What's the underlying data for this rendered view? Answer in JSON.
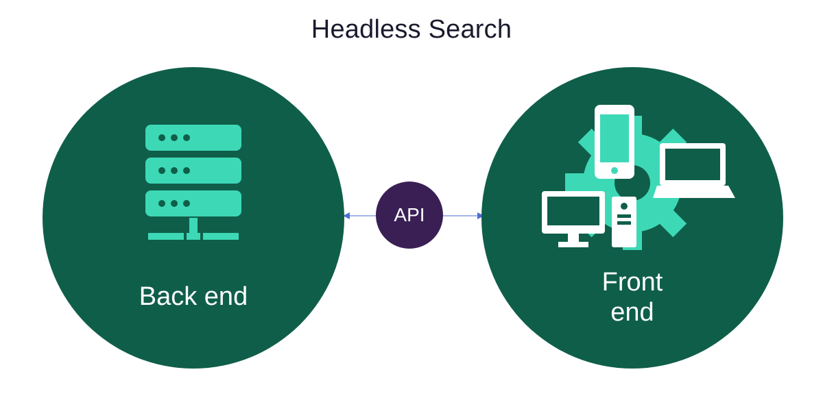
{
  "title": "Headless Search",
  "left": {
    "label": "Back end",
    "bg_color": "#0f5e4a",
    "icon_color": "#3dd9b6",
    "icon_name": "server-icon"
  },
  "center": {
    "label": "API",
    "bg_color": "#3a1f55",
    "arrow_color": "#4a6fd4"
  },
  "right": {
    "label": "Front\nend",
    "bg_color": "#0f5e4a",
    "gear_color": "#3dd9b6",
    "device_color": "#ffffff",
    "icon_name": "devices-gear-icon"
  }
}
